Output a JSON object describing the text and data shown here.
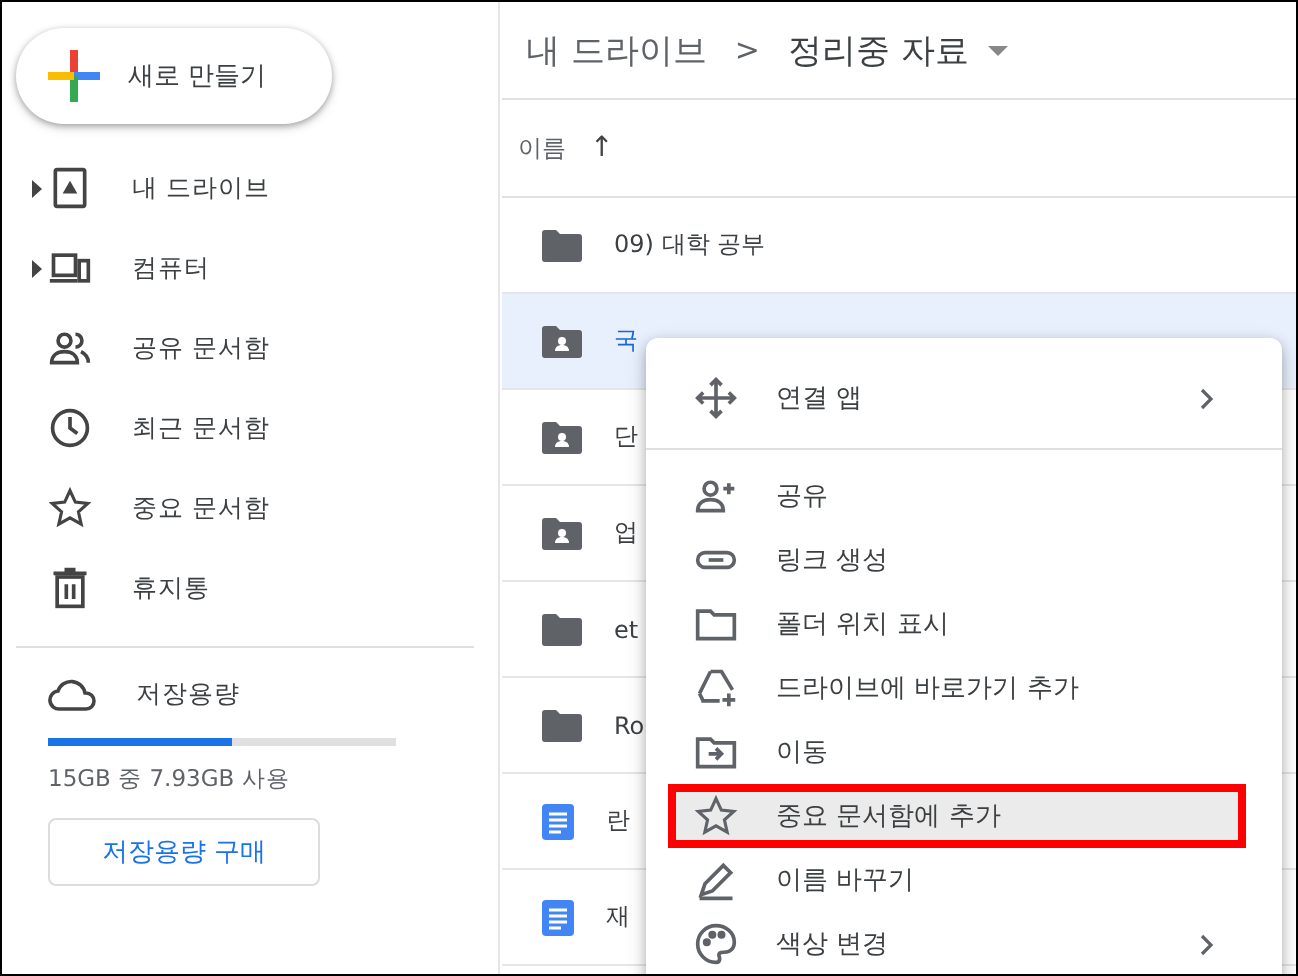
{
  "new_button": {
    "label": "새로 만들기"
  },
  "sidebar": {
    "items": [
      {
        "label": "내 드라이브",
        "expandable": true
      },
      {
        "label": "컴퓨터",
        "expandable": true
      },
      {
        "label": "공유 문서함",
        "expandable": false
      },
      {
        "label": "최근 문서함",
        "expandable": false
      },
      {
        "label": "중요 문서함",
        "expandable": false
      },
      {
        "label": "휴지통",
        "expandable": false
      }
    ]
  },
  "storage": {
    "label": "저장용량",
    "level": 0.53,
    "usage": "15GB 중 7.93GB 사용",
    "buy_button": "저장용량 구매"
  },
  "breadcrumb": {
    "parent": "내 드라이브",
    "separator": ">",
    "current": "정리중 자료"
  },
  "table": {
    "columns": [
      {
        "label": "이름",
        "sort": "↑"
      }
    ],
    "rows": [
      {
        "name": "09) 대학 공부",
        "kind": "folder",
        "selected": false
      },
      {
        "name": "국",
        "kind": "shared-folder",
        "selected": true
      },
      {
        "name": "단",
        "kind": "shared-folder",
        "selected": false
      },
      {
        "name": "업",
        "kind": "shared-folder",
        "selected": false
      },
      {
        "name": "et",
        "kind": "folder",
        "selected": false
      },
      {
        "name": "Ro",
        "kind": "folder",
        "selected": false
      },
      {
        "name": "란",
        "kind": "doc",
        "selected": false
      },
      {
        "name": "재",
        "kind": "doc",
        "selected": false
      }
    ]
  },
  "context_menu": {
    "items": [
      {
        "label": "연결 앱",
        "submenu": true,
        "highlighted": false,
        "divider_after": true
      },
      {
        "label": "공유",
        "submenu": false,
        "highlighted": false,
        "divider_after": false
      },
      {
        "label": "링크 생성",
        "submenu": false,
        "highlighted": false,
        "divider_after": false
      },
      {
        "label": "폴더 위치 표시",
        "submenu": false,
        "highlighted": false,
        "divider_after": false
      },
      {
        "label": "드라이브에 바로가기 추가",
        "submenu": false,
        "highlighted": false,
        "divider_after": false
      },
      {
        "label": "이동",
        "submenu": false,
        "highlighted": false,
        "divider_after": false
      },
      {
        "label": "중요 문서함에 추가",
        "submenu": false,
        "highlighted": true,
        "divider_after": false
      },
      {
        "label": "이름 바꾸기",
        "submenu": false,
        "highlighted": false,
        "divider_after": false
      },
      {
        "label": "색상 변경",
        "submenu": true,
        "highlighted": false,
        "divider_after": false
      }
    ]
  }
}
